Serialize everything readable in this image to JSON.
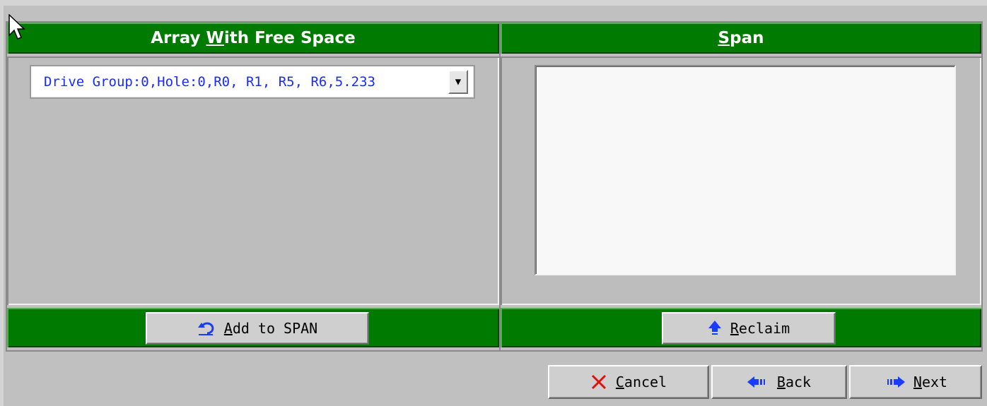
{
  "left_panel": {
    "title_pre": "Array ",
    "title_key": "W",
    "title_post": "ith Free Space",
    "combo_value": "Drive Group:0,Hole:0,R0, R1, R5, R6,5.233",
    "add_button": {
      "key": "A",
      "rest": "dd to SPAN"
    }
  },
  "right_panel": {
    "title_key": "S",
    "title_post": "pan",
    "span_items": [],
    "reclaim_button": {
      "key": "R",
      "rest": "eclaim"
    }
  },
  "footer_buttons": {
    "cancel": {
      "key": "C",
      "rest": "ancel"
    },
    "back": {
      "key": "B",
      "rest": "ack"
    },
    "next": {
      "key": "N",
      "rest": "ext"
    }
  },
  "colors": {
    "header_green": "#007a00",
    "panel_gray": "#bdbdbd",
    "combo_text_blue": "#1a2bff",
    "cancel_red": "#e01010",
    "arrow_blue": "#1a3cff"
  },
  "icons": {
    "add": "undo-arrow-icon",
    "reclaim": "up-arrow-icon",
    "cancel": "x-icon",
    "back": "left-arrow-icon",
    "next": "right-arrow-icon",
    "cursor": "mouse-pointer-icon",
    "dropdown": "dropdown-triangle-icon"
  }
}
